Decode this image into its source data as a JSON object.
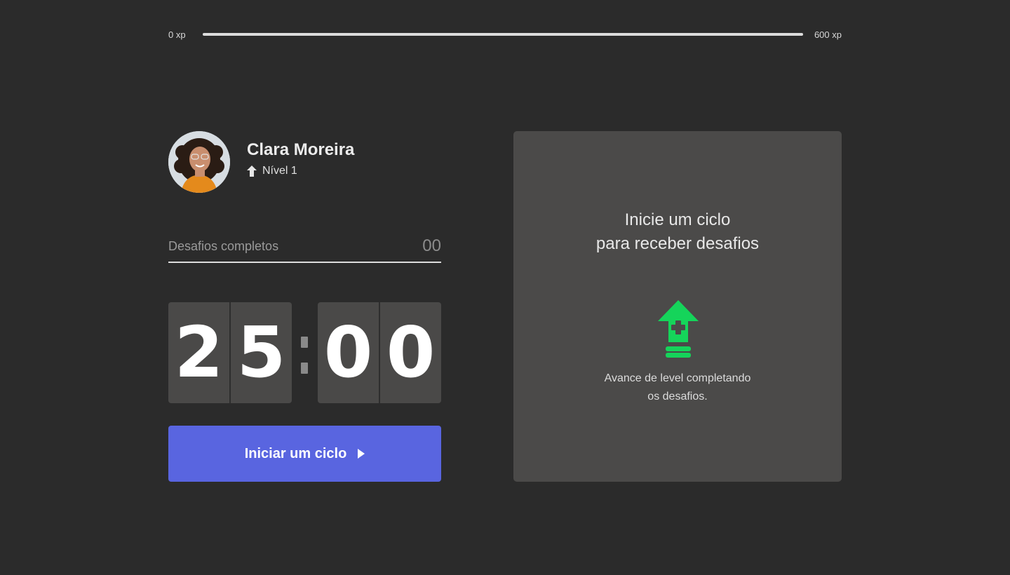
{
  "xp": {
    "min_label": "0 xp",
    "max_label": "600 xp",
    "current": 0,
    "max": 600,
    "fill_color": "#4cd62b"
  },
  "profile": {
    "name": "Clara Moreira",
    "level_label": "Nível 1",
    "level_icon": "level-up-arrow-icon"
  },
  "challenges": {
    "label": "Desafios completos",
    "count": "00"
  },
  "countdown": {
    "minutes": [
      "2",
      "5"
    ],
    "seconds": [
      "0",
      "0"
    ]
  },
  "start_button": {
    "label": "Iniciar um ciclo",
    "icon": "play-icon",
    "color": "#5965e0"
  },
  "challenge_box": {
    "title_line1": "Inicie um ciclo",
    "title_line2": "para receber desafios",
    "icon": "level-up-icon",
    "icon_color": "#4cd62b",
    "hint_line1": "Avance de level completando",
    "hint_line2": "os desafios."
  },
  "colors": {
    "background": "#2b2b2b",
    "panel": "#4b4a49",
    "accent": "#5965e0",
    "success": "#4cd62b"
  }
}
